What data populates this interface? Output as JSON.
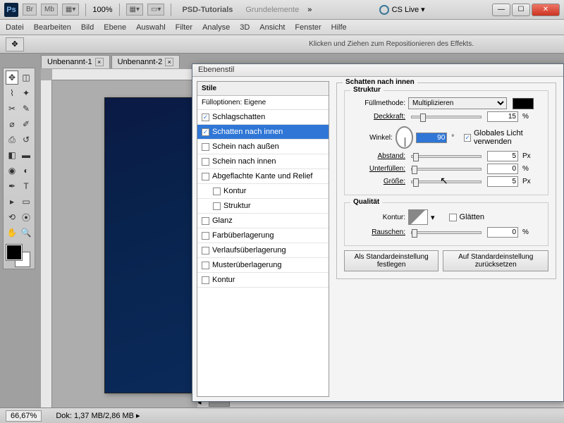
{
  "app": {
    "ps": "Ps",
    "br": "Br",
    "mb": "Mb",
    "zoom": "100%",
    "brand": "PSD-Tutorials",
    "workspace": "Grundelemente",
    "cslive": "CS Live ▾"
  },
  "menu": [
    "Datei",
    "Bearbeiten",
    "Bild",
    "Ebene",
    "Auswahl",
    "Filter",
    "Analyse",
    "3D",
    "Ansicht",
    "Fenster",
    "Hilfe"
  ],
  "optbar_hint": "Klicken und Ziehen zum Repositionieren des Effekts.",
  "tabs": [
    {
      "label": "Unbenannt-1"
    },
    {
      "label": "Unbenannt-2"
    }
  ],
  "status": {
    "zoom": "66,67%",
    "dok_label": "Dok:",
    "dok": "1,37 MB/2,86 MB"
  },
  "dialog": {
    "title": "Ebenenstil",
    "stile_head": "Stile",
    "fill_opts": "Fülloptionen: Eigene",
    "styles": [
      {
        "label": "Schlagschatten",
        "checked": true,
        "selected": false
      },
      {
        "label": "Schatten nach innen",
        "checked": true,
        "selected": true
      },
      {
        "label": "Schein nach außen",
        "checked": false
      },
      {
        "label": "Schein nach innen",
        "checked": false
      },
      {
        "label": "Abgeflachte Kante und Relief",
        "checked": false
      },
      {
        "label": "Kontur",
        "checked": false,
        "indent": true
      },
      {
        "label": "Struktur",
        "checked": false,
        "indent": true
      },
      {
        "label": "Glanz",
        "checked": false
      },
      {
        "label": "Farbüberlagerung",
        "checked": false
      },
      {
        "label": "Verlaufsüberlagerung",
        "checked": false
      },
      {
        "label": "Musterüberlagerung",
        "checked": false
      },
      {
        "label": "Kontur",
        "checked": false
      }
    ],
    "group_title": "Schatten nach innen",
    "struct_title": "Struktur",
    "blend_label": "Füllmethode:",
    "blend_value": "Multiplizieren",
    "opacity_label": "Deckkraft:",
    "opacity_value": "15",
    "pct": "%",
    "angle_label": "Winkel:",
    "angle_value": "90",
    "deg": "°",
    "global_light": "Globales Licht verwenden",
    "distance_label": "Abstand:",
    "distance_value": "5",
    "px": "Px",
    "choke_label": "Unterfüllen:",
    "choke_value": "0",
    "size_label": "Größe:",
    "size_value": "5",
    "quality_title": "Qualität",
    "contour_label": "Kontur:",
    "antialiased": "Glätten",
    "noise_label": "Rauschen:",
    "noise_value": "0",
    "btn_default": "Als Standardeinstellung festlegen",
    "btn_reset": "Auf Standardeinstellung zurücksetzen"
  }
}
